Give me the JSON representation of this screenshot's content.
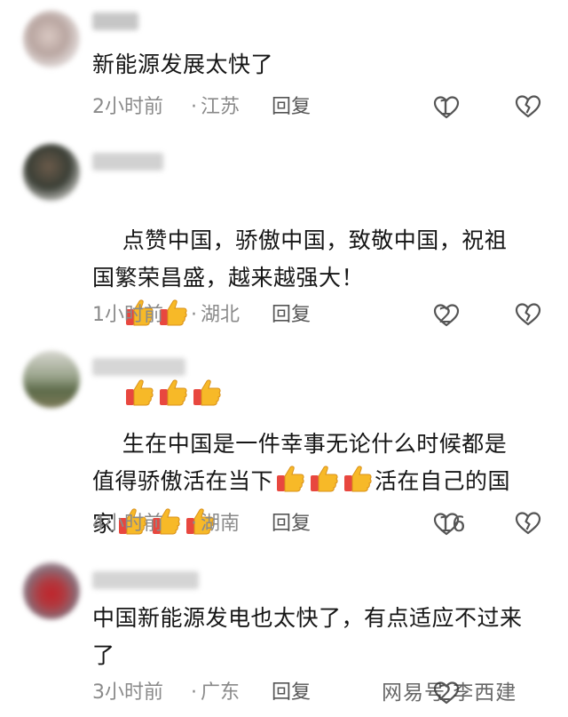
{
  "comments": [
    {
      "text": "新能源发展太快了",
      "time": "2小时前",
      "location": "江苏",
      "reply_label": "回复",
      "like_count": "1",
      "emoji_count": 0
    },
    {
      "text_before": "点赞中国，骄傲中国，致敬中国，祝祖国繁荣昌盛，越来越强大！",
      "time": "1小时前",
      "location": "湖北",
      "reply_label": "回复",
      "like_count": "2"
    },
    {
      "text_before": "生在中国是一件幸事无论什么时候都是值得骄傲活在当下",
      "text_middle": "活在自己的国家",
      "time": "4小时前",
      "location": "湖南",
      "reply_label": "回复",
      "like_count": "16"
    },
    {
      "text": "中国新能源发电也太快了，有点适应不过来了",
      "time": "3小时前",
      "location": "广东",
      "reply_label": "回复",
      "like_count": "2"
    }
  ],
  "separator_dot": "·",
  "watermark": "网易号 李西建",
  "icons": {
    "like": "heart-outline-icon",
    "dislike": "broken-heart-icon",
    "emoji": "thumbs-up-emoji"
  },
  "colors": {
    "meta_gray": "#8a8a8a",
    "thumb_yellow": "#f7b928",
    "thumb_red": "#e8473f"
  }
}
